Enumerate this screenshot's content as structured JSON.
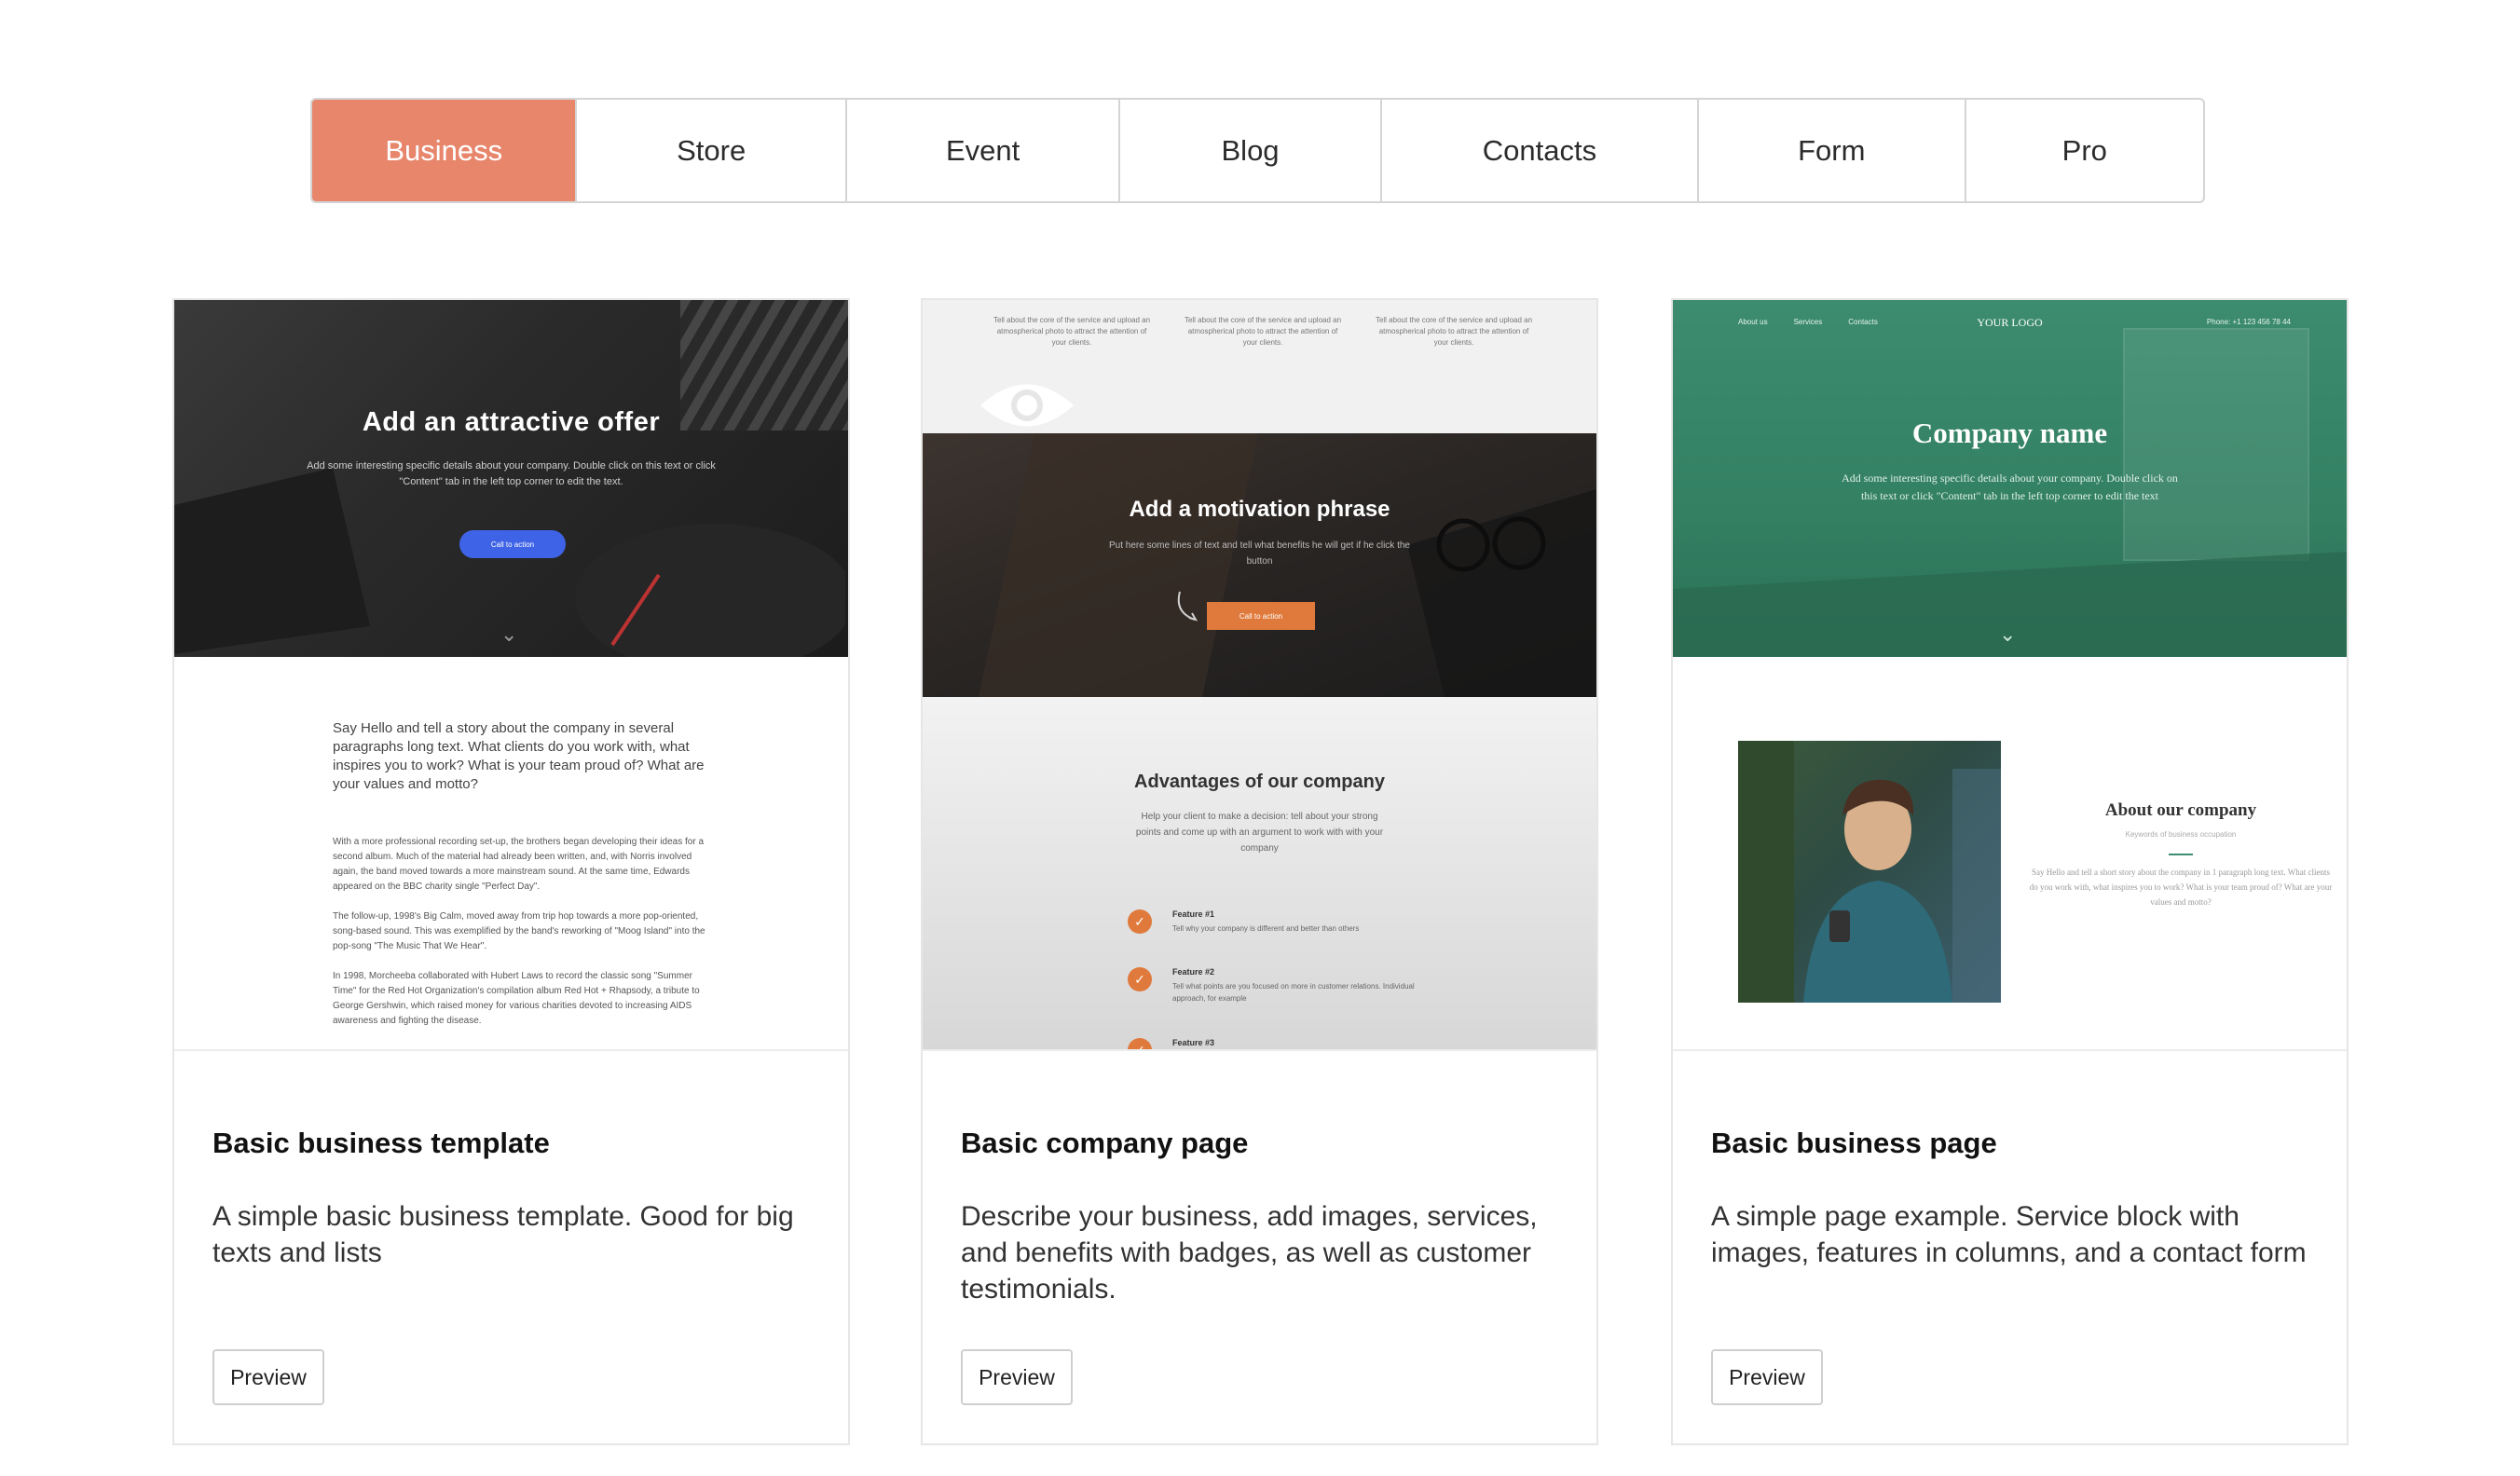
{
  "tabs": [
    {
      "label": "Business",
      "active": true
    },
    {
      "label": "Store",
      "active": false
    },
    {
      "label": "Event",
      "active": false
    },
    {
      "label": "Blog",
      "active": false
    },
    {
      "label": "Contacts",
      "active": false
    },
    {
      "label": "Form",
      "active": false
    },
    {
      "label": "Pro",
      "active": false
    }
  ],
  "colors": {
    "accent": "#e8866c",
    "green": "#3d8c70",
    "orange": "#e07a3c",
    "blue": "#3f63e6"
  },
  "cards": [
    {
      "title": "Basic business template",
      "description": "A simple basic business template. Good for big texts and lists",
      "button": "Preview",
      "preview": {
        "headline": "Add an attractive offer",
        "sub": "Add some interesting specific details about your company. Double click on this text or click \"Content\" tab in the left top corner to edit the text.",
        "cta": "Call to action",
        "intro": "Say Hello and tell a story about the company in several paragraphs long text. What clients do you work with, what inspires you to work? What is your team proud of? What are your values and motto?",
        "paragraphs": [
          "With a more professional recording set-up, the brothers began developing their ideas for a second album. Much of the material had already been written, and, with Norris involved again, the band moved towards a more mainstream sound. At the same time, Edwards appeared on the BBC charity single \"Perfect Day\".",
          "The follow-up, 1998's Big Calm, moved away from trip hop towards a more pop-oriented, song-based sound. This was exemplified by the band's reworking of \"Moog Island\" into the pop-song \"The Music That We Hear\".",
          "In 1998, Morcheeba collaborated with Hubert Laws to record the classic song \"Summer Time\" for the Red Hot Organization's compilation album Red Hot + Rhapsody, a tribute to George Gershwin, which raised money for various charities devoted to increasing AIDS awareness and fighting the disease."
        ]
      }
    },
    {
      "title": "Basic company page",
      "description": "Describe your business, add images, services, and benefits with badges, as well as customer testimonials.",
      "button": "Preview",
      "preview": {
        "columns": [
          "Tell about the core of the service and upload an atmospherical photo to attract the attention of your clients.",
          "Tell about the core of the service and upload an atmospherical photo to attract the attention of your clients.",
          "Tell about the core of the service and upload an atmospherical photo to attract the attention of your clients."
        ],
        "headline": "Add a motivation phrase",
        "sub": "Put here some lines of text and tell what benefits he will get if he click the button",
        "cta": "Call to action",
        "advantages_title": "Advantages of our company",
        "advantages_sub": "Help your client to make a decision: tell about your strong points and come up with an argument to work with with your company",
        "features": [
          {
            "title": "Feature #1",
            "text": "Tell why your company is different and better than others"
          },
          {
            "title": "Feature #2",
            "text": "Tell what points are you focused on more in customer relations. Individual approach, for example"
          },
          {
            "title": "Feature #3",
            "text": ""
          }
        ]
      }
    },
    {
      "title": "Basic business page",
      "description": "A simple page example. Service block with images, features in columns, and a contact form",
      "button": "Preview",
      "preview": {
        "nav": [
          "About us",
          "Services",
          "Contacts"
        ],
        "logo": "YOUR LOGO",
        "phone": "Phone: +1 123 456 78 44",
        "headline": "Company name",
        "sub": "Add some interesting specific details about your company. Double click on this text or click \"Content\" tab in the left top corner to edit the text",
        "about_title": "About our company",
        "keywords": "Keywords of business occupation",
        "about_text": "Say Hello and tell a short story about the company in 1 paragraph long text. What clients do you work with, what inspires you to work? What is your team proud of? What are your values and motto?"
      }
    }
  ]
}
